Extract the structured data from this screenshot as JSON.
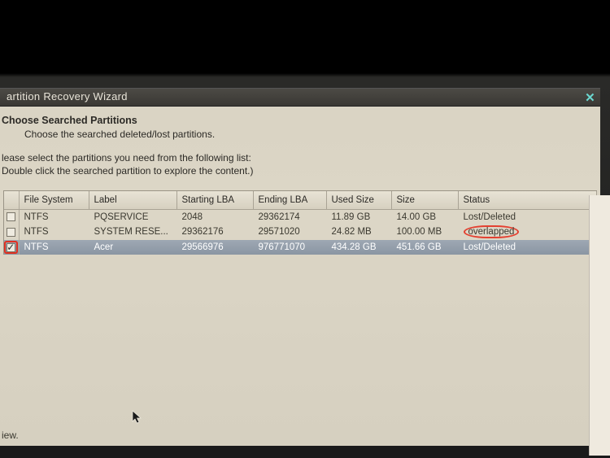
{
  "titlebar": {
    "title": "artition Recovery Wizard"
  },
  "header": {
    "title": "Choose Searched Partitions",
    "subtitle": "Choose the searched deleted/lost partitions."
  },
  "instructions": {
    "line1": "lease select the partitions you need from the following list:",
    "line2": "Double click the searched partition to explore the content.)"
  },
  "columns": {
    "fs": "File System",
    "label": "Label",
    "start": "Starting LBA",
    "end": "Ending LBA",
    "used": "Used Size",
    "size": "Size",
    "status": "Status"
  },
  "rows": [
    {
      "checked": false,
      "selected": false,
      "highlightCheck": false,
      "fs": "NTFS",
      "label": "PQSERVICE",
      "start": "2048",
      "end": "29362174",
      "used": "11.89 GB",
      "size": "14.00 GB",
      "status": "Lost/Deleted",
      "statusHighlight": false
    },
    {
      "checked": false,
      "selected": false,
      "highlightCheck": false,
      "fs": "NTFS",
      "label": "SYSTEM RESE...",
      "start": "29362176",
      "end": "29571020",
      "used": "24.82 MB",
      "size": "100.00 MB",
      "status": "overlapped",
      "statusHighlight": true
    },
    {
      "checked": true,
      "selected": true,
      "highlightCheck": true,
      "fs": "NTFS",
      "label": "Acer",
      "start": "29566976",
      "end": "976771070",
      "used": "434.28 GB",
      "size": "451.66 GB",
      "status": "Lost/Deleted",
      "statusHighlight": false
    }
  ],
  "footer": {
    "text": "iew."
  }
}
